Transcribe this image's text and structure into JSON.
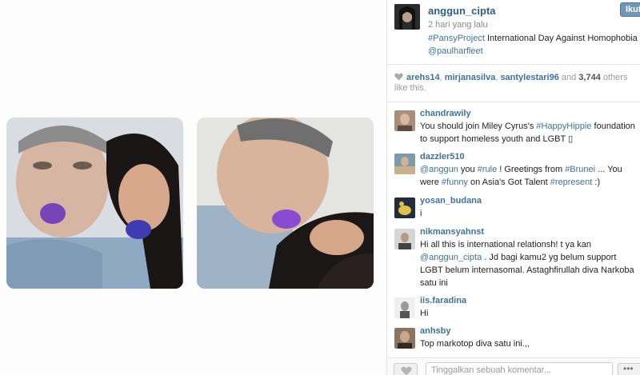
{
  "post": {
    "owner": "anggun_cipta",
    "follow_label": "Ikuti",
    "time_ago": "2 hari yang lalu",
    "caption_tag": "#PansyProject",
    "caption_text": " International Day Against Homophobia",
    "caption_mention": "@paulharfleet"
  },
  "likes": {
    "users": [
      "arehs14",
      "mirjanasilva",
      "santylestari96"
    ],
    "sep1": ", ",
    "sep2": ", ",
    "and_text": " and ",
    "count": "3,744",
    "rest": " others like this."
  },
  "comments": [
    {
      "user": "chandrawily",
      "pre": "You should join Miley Cyrus's ",
      "tag": "#HappyHippie",
      "post": " foundation to support homeless youth and LGBT ▯"
    },
    {
      "user": "dazzler510",
      "m1": "@anggun",
      "t1": " you ",
      "h1": "#rule",
      "t2": " ! Greetings from ",
      "h2": "#Brunei",
      "t3": " ... You were ",
      "h3": "#funny",
      "t4": " on Asia's Got Talent ",
      "h4": "#represent",
      "t5": " :)"
    },
    {
      "user": "yosan_budana",
      "text": "i"
    },
    {
      "user": "nikmansyahnst",
      "pre": "Hi all this is international relationsh! t ya kan ",
      "mention": "@anggun_cipta",
      "post": " . Jd bagi kamu2 yg belum support LGBT belum internasomal. Astaghfirullah diva Narkoba satu ini"
    },
    {
      "user": "iis.faradina",
      "text": "Hi"
    },
    {
      "user": "anhsby",
      "text": "Top markotop diva satu ini.,,"
    }
  ],
  "footer": {
    "comment_placeholder": "Tinggalkan sebuah komentar...",
    "more_label": "•••"
  },
  "colors": {
    "link": "#3f729b",
    "follow_button": "#6f97b6"
  }
}
